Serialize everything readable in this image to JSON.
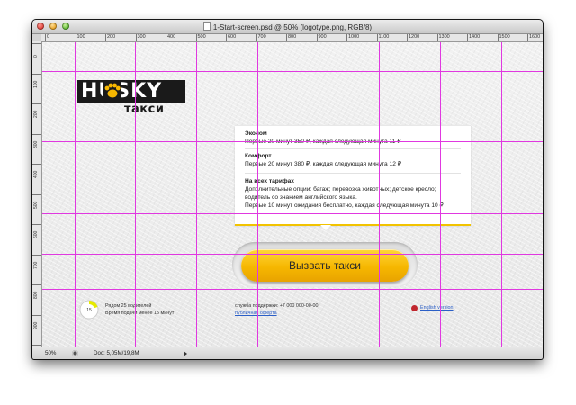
{
  "window": {
    "title": "1-Start-screen.psd @ 50% (logotype.png, RGB/8)"
  },
  "rulers": {
    "top": [
      "0",
      "100",
      "200",
      "300",
      "400",
      "500",
      "600",
      "700",
      "800",
      "900",
      "1000",
      "1100",
      "1200",
      "1300",
      "1400",
      "1500",
      "1600"
    ],
    "left": [
      "0",
      "100",
      "200",
      "300",
      "400",
      "500",
      "600",
      "700",
      "800",
      "900",
      "1000"
    ]
  },
  "logo": {
    "brand": "HUSKY",
    "subtitle": "такси",
    "brand_color": "#1a1a1a",
    "accent_color": "#f6b700"
  },
  "tariffs": [
    {
      "name": "Эконом",
      "description": "Первые 20 минут 350 ₽, каждая следующая минута 11 ₽"
    },
    {
      "name": "Комфорт",
      "description": "Первые 20 минут 380 ₽, каждая следующая минута 12 ₽"
    }
  ],
  "all_tariffs": {
    "title": "На всех тарифах",
    "options_line1": "Дополнительные опции: багаж; перевозка животных; детское кресло;",
    "options_line2": "водитель со знанием английского языка.",
    "waiting": "Первые 10 минут ожидания бесплатно, каждая следующая минута 10 ₽"
  },
  "call_button": {
    "label": "Вызвать такси",
    "color": "#f6b700"
  },
  "footer": {
    "timer_value": "15",
    "drivers_nearby": "Рядом 25 водителей",
    "pickup_time": "Время подачи менее 15 минут",
    "support": "служба поддержки: +7 000 000-00-00",
    "public_offer": "публичная оферта",
    "english_version": "English version"
  },
  "statusbar": {
    "zoom": "50%",
    "doc_info": "Doc: 5,05M/19,8M"
  }
}
